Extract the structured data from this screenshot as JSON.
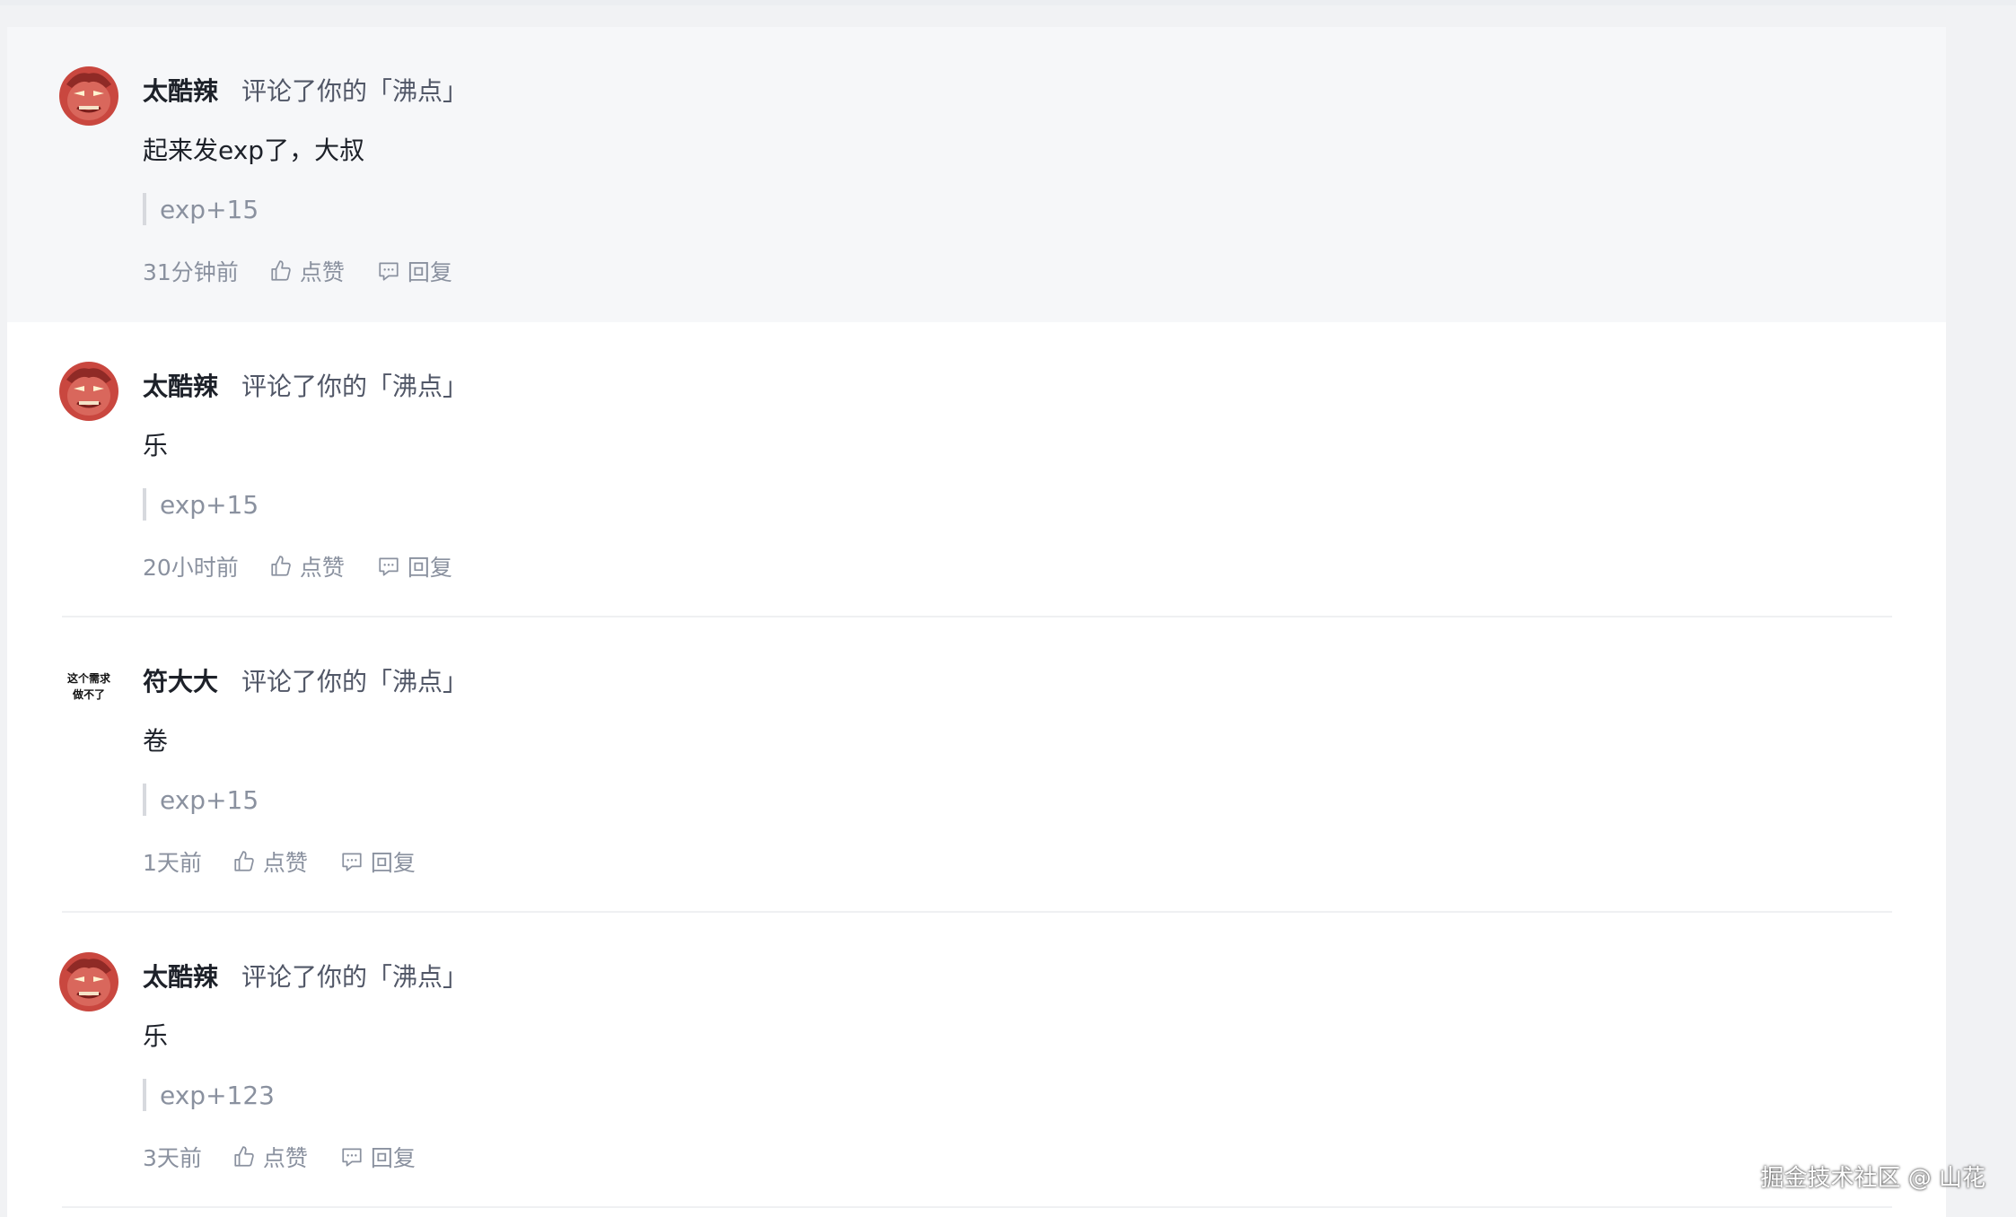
{
  "notifications": [
    {
      "username": "太酷辣",
      "action": "评论了你的「沸点」",
      "content": "起来发exp了，大叔",
      "quote": "exp+15",
      "time": "31分钟前",
      "like_label": "点赞",
      "reply_label": "回复",
      "avatar": "red-cartoon-face",
      "highlighted": true
    },
    {
      "username": "太酷辣",
      "action": "评论了你的「沸点」",
      "content": "乐",
      "quote": "exp+15",
      "time": "20小时前",
      "like_label": "点赞",
      "reply_label": "回复",
      "avatar": "red-cartoon-face",
      "highlighted": false
    },
    {
      "username": "符大大",
      "action": "评论了你的「沸点」",
      "content": "卷",
      "quote": "exp+15",
      "time": "1天前",
      "like_label": "点赞",
      "reply_label": "回复",
      "avatar": "text-avatar",
      "avatar_text_line1": "这个需求",
      "avatar_text_line2": "做不了",
      "highlighted": false
    },
    {
      "username": "太酷辣",
      "action": "评论了你的「沸点」",
      "content": "乐",
      "quote": "exp+123",
      "time": "3天前",
      "like_label": "点赞",
      "reply_label": "回复",
      "avatar": "red-cartoon-face",
      "highlighted": false
    }
  ],
  "watermark": "掘金技术社区 @ 山花",
  "colors": {
    "highlight_bg": "#f6f7f9",
    "text_primary": "#1d2129",
    "text_secondary": "#515767",
    "text_muted": "#8a919f",
    "avatar_red": "#c94a42"
  }
}
